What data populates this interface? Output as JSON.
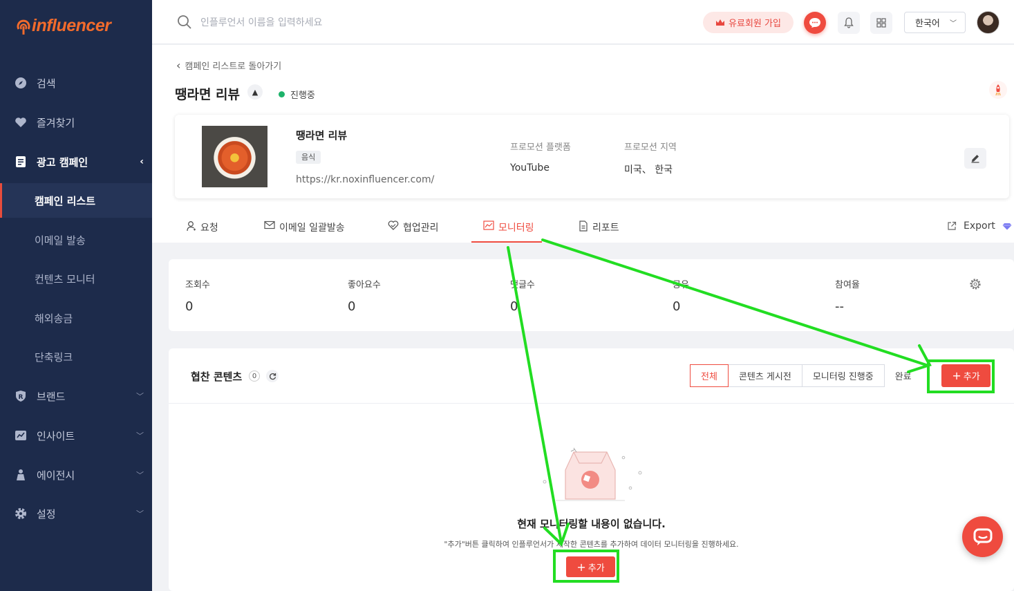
{
  "brand": {
    "logo_text": "influencer"
  },
  "sidebar": {
    "items": [
      {
        "label": "검색"
      },
      {
        "label": "즐겨찾기"
      },
      {
        "label": "광고 캠페인"
      },
      {
        "label": "브랜드"
      },
      {
        "label": "인사이트"
      },
      {
        "label": "에이전시"
      },
      {
        "label": "설정"
      }
    ],
    "sub_items": [
      {
        "label": "캠페인 리스트"
      },
      {
        "label": "이메일 발송"
      },
      {
        "label": "컨텐츠 모니터"
      },
      {
        "label": "해외송금"
      },
      {
        "label": "단축링크"
      }
    ]
  },
  "topbar": {
    "search_placeholder": "인플루언서 이름을 입력하세요",
    "vip_label": "유료회원 가입",
    "language": "한국어"
  },
  "campaign": {
    "back_label": "캠페인 리스트로 돌아가기",
    "title": "땡라면 리뷰",
    "status": "진행중",
    "product_name": "땡라면 리뷰",
    "category_tag": "음식",
    "url": "https://kr.noxinfluencer.com/",
    "platform_label": "프로모션 플랫폼",
    "platform_value": "YouTube",
    "region_label": "프로모션 지역",
    "region_value": "미국、 한국"
  },
  "tabs": [
    {
      "label": "요청"
    },
    {
      "label": "이메일 일괄발송"
    },
    {
      "label": "협업관리"
    },
    {
      "label": "모니터링"
    },
    {
      "label": "리포트"
    }
  ],
  "export_label": "Export",
  "stats": [
    {
      "label": "조회수",
      "value": "0"
    },
    {
      "label": "좋아요수",
      "value": "0"
    },
    {
      "label": "댓글수",
      "value": "0"
    },
    {
      "label": "공유",
      "value": "0"
    },
    {
      "label": "참여율",
      "value": "--"
    }
  ],
  "content_section": {
    "title": "협찬 콘텐츠",
    "count": "0",
    "filters": [
      "전체",
      "콘텐츠 게시전",
      "모니터링 진행중",
      "완료"
    ],
    "add_label": "추가",
    "empty_title": "현재 모니터링할 내용이 없습니다.",
    "empty_sub": "\"추가\"버튼 클릭하여 인플루언서가 제작한 콘텐츠를 추가하여 데이터 모니터링을 진행하세요.",
    "empty_add_label": "추가"
  },
  "colors": {
    "sidebar": "#1d2b4b",
    "accent": "#ef4b3f",
    "annotation": "#22dd22"
  }
}
